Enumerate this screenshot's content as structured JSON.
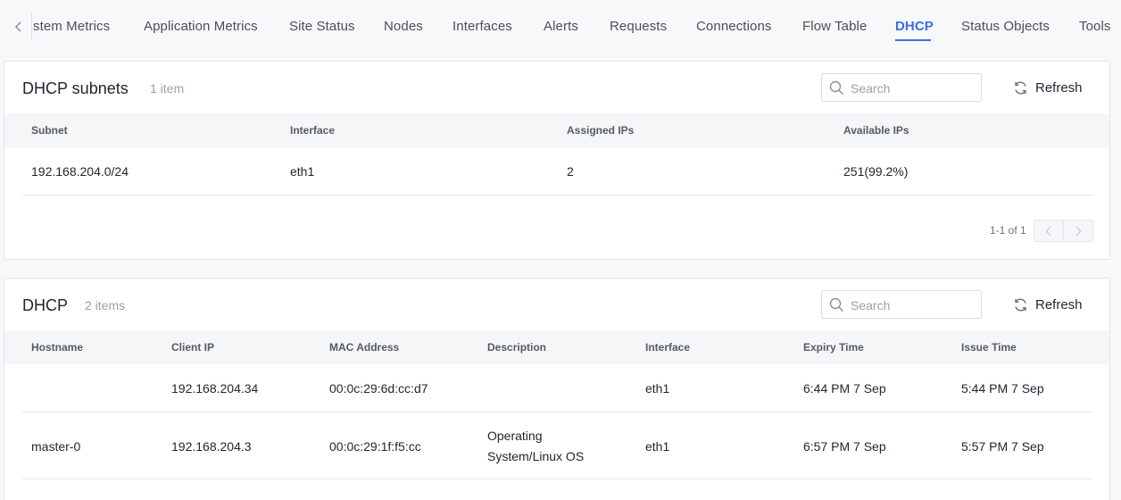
{
  "tabs": {
    "items": [
      {
        "label": "stem Metrics"
      },
      {
        "label": "Application Metrics"
      },
      {
        "label": "Site Status"
      },
      {
        "label": "Nodes"
      },
      {
        "label": "Interfaces"
      },
      {
        "label": "Alerts"
      },
      {
        "label": "Requests"
      },
      {
        "label": "Connections"
      },
      {
        "label": "Flow Table"
      },
      {
        "label": "DHCP"
      },
      {
        "label": "Status Objects"
      },
      {
        "label": "Tools"
      }
    ],
    "active": "DHCP",
    "prev_icon": "chevron-left-icon"
  },
  "subnets": {
    "title": "DHCP subnets",
    "count": "1 item",
    "search_placeholder": "Search",
    "refresh_label": "Refresh",
    "columns": [
      "Subnet",
      "Interface",
      "Assigned IPs",
      "Available IPs"
    ],
    "rows": [
      [
        "192.168.204.0/24",
        "eth1",
        "2",
        "251(99.2%)"
      ]
    ],
    "pagination": "1-1 of 1"
  },
  "leases": {
    "title": "DHCP",
    "count": "2 items",
    "search_placeholder": "Search",
    "refresh_label": "Refresh",
    "columns": [
      "Hostname",
      "Client IP",
      "MAC Address",
      "Description",
      "Interface",
      "Expiry Time",
      "Issue Time"
    ],
    "rows": [
      [
        "",
        "192.168.204.34",
        "00:0c:29:6d:cc:d7",
        "",
        "eth1",
        "6:44 PM 7 Sep",
        "5:44 PM 7 Sep"
      ],
      [
        "master-0",
        "192.168.204.3",
        "00:0c:29:1f:f5:cc",
        "Operating System/Linux OS",
        "eth1",
        "6:57 PM 7 Sep",
        "5:57 PM 7 Sep"
      ]
    ]
  },
  "colors": {
    "accent": "#3d6fe0",
    "text": "#1f2430",
    "muted": "#9aa0aa",
    "header_bg": "#f5f6f8",
    "border": "#e4e6eb"
  }
}
